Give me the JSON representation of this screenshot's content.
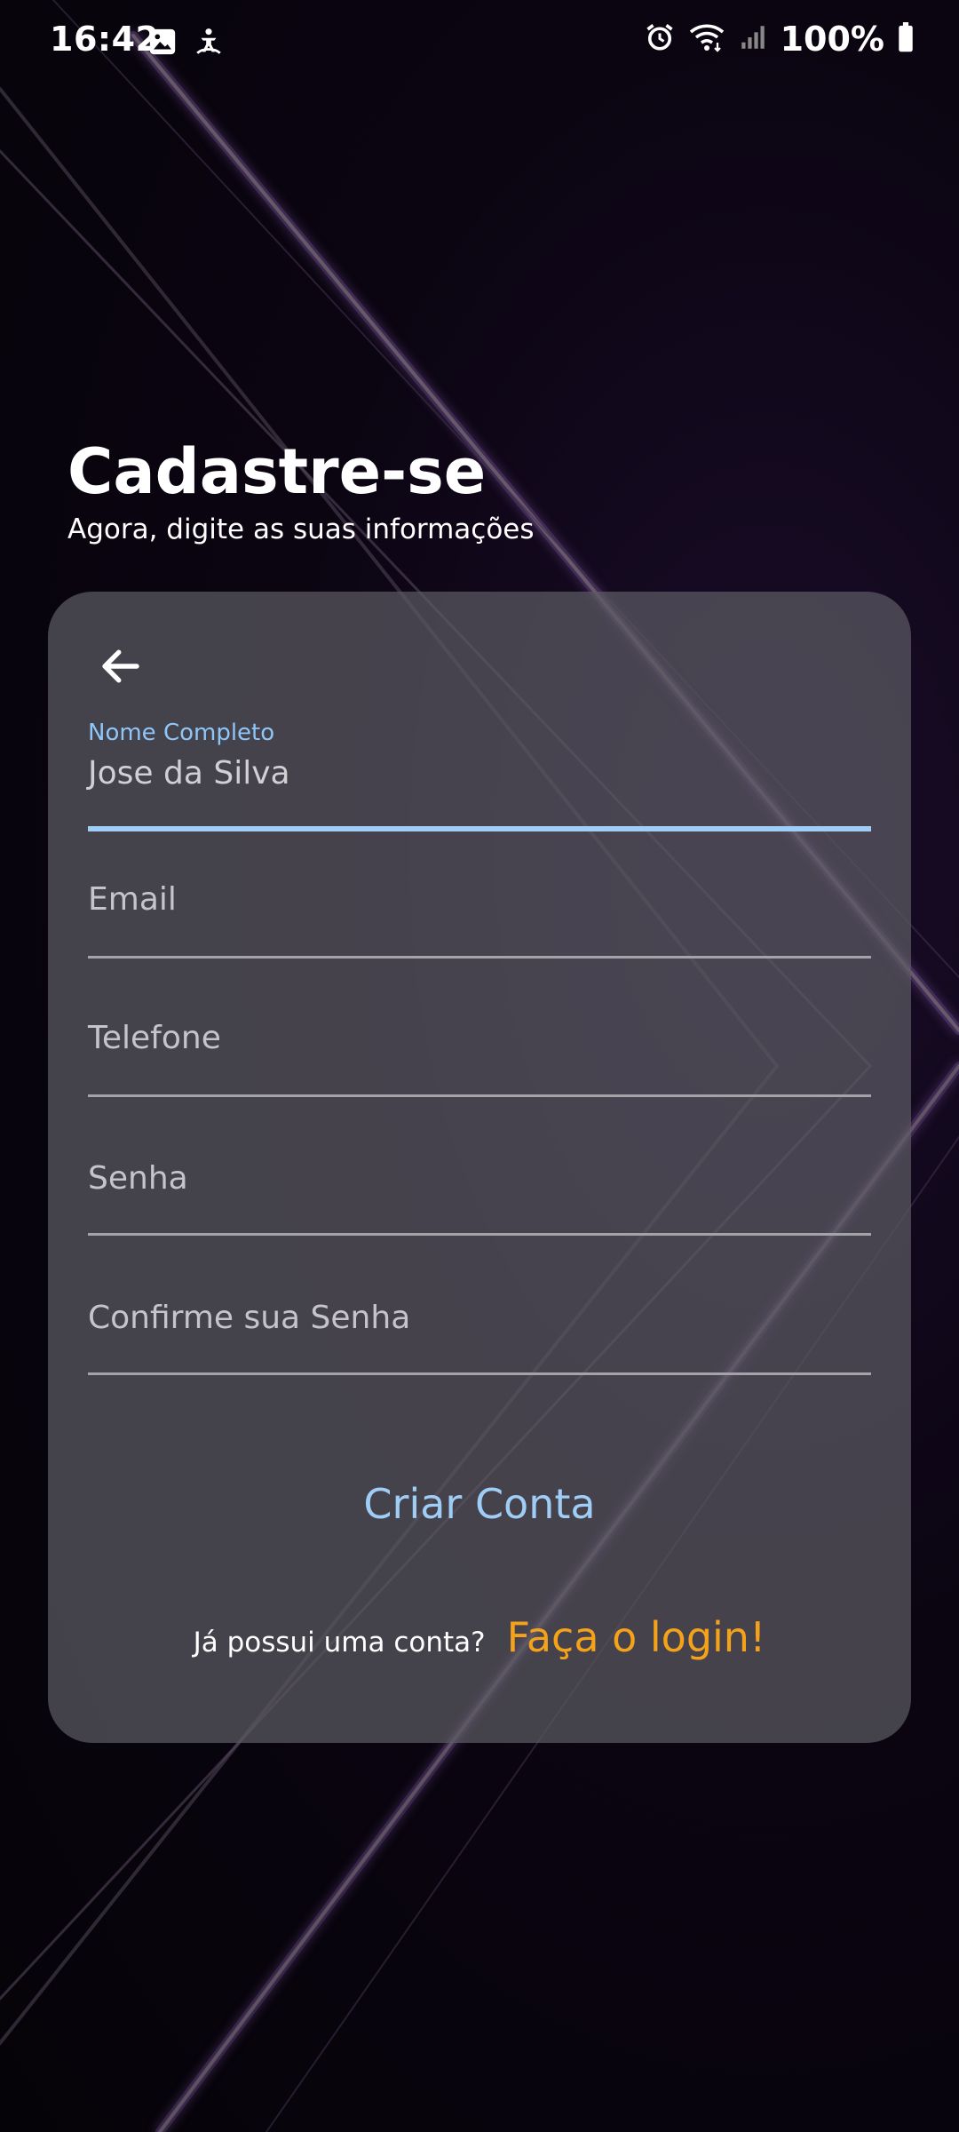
{
  "status_bar": {
    "time": "16:42",
    "battery": "100%",
    "icons_left": [
      "image-icon",
      "accessibility-icon"
    ],
    "icons_right": [
      "alarm-icon",
      "wifi-icon",
      "signal-icon",
      "battery-icon"
    ]
  },
  "header": {
    "title": "Cadastre-se",
    "subtitle": "Agora, digite as suas informações"
  },
  "form": {
    "back_icon": "arrow-left-icon",
    "full_name": {
      "label": "Nome Completo",
      "value": "Jose da Silva"
    },
    "email": {
      "placeholder": "Email",
      "value": ""
    },
    "phone": {
      "placeholder": "Telefone",
      "value": ""
    },
    "password": {
      "placeholder": "Senha",
      "value": ""
    },
    "confirm_password": {
      "placeholder": "Confirme sua Senha",
      "value": ""
    },
    "create_button": "Criar Conta",
    "login_question": "Já possui uma conta?",
    "login_link": "Faça o login!"
  },
  "colors": {
    "accent": "#9fcdf6",
    "link": "#f5a21b",
    "card": "#5c5a62",
    "background": "#07040b"
  }
}
